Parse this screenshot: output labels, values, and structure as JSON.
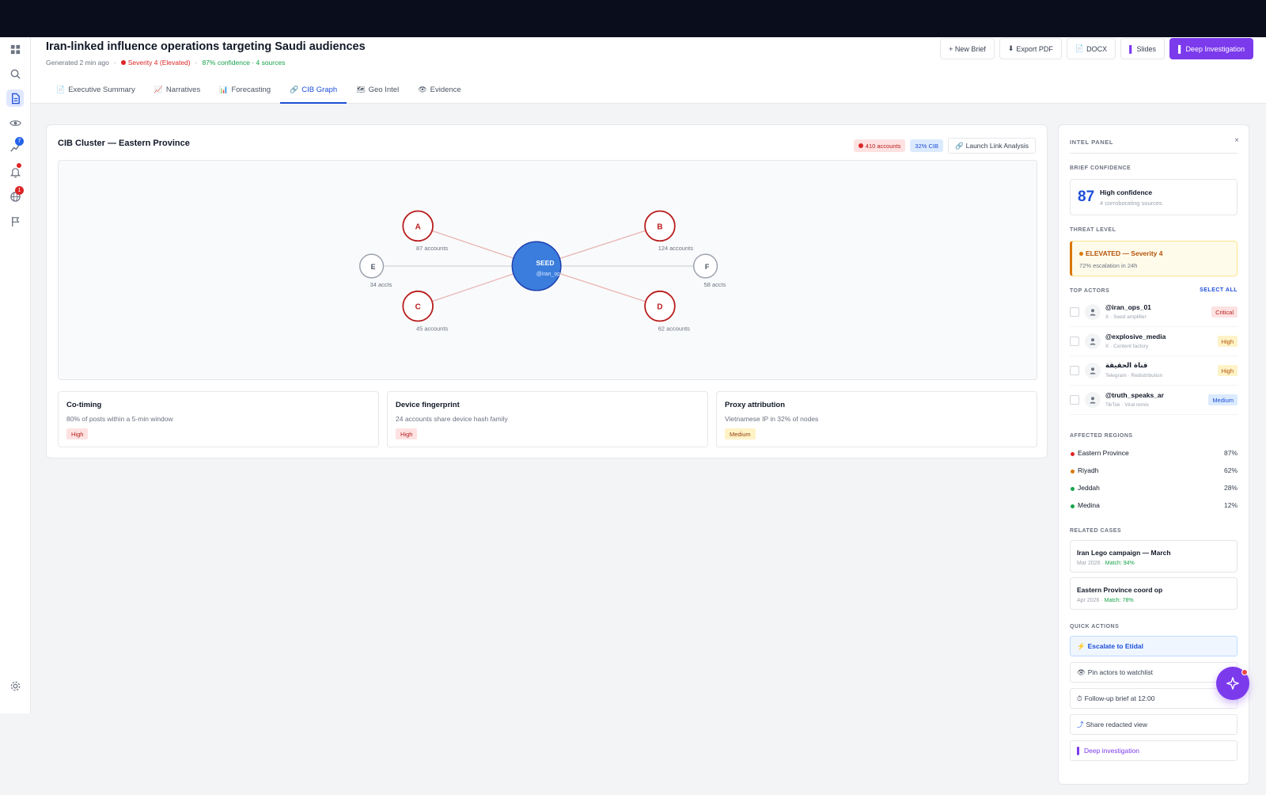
{
  "header": {
    "title": "Iran-linked influence operations targeting Saudi audiences",
    "generated": "Generated 2 min ago",
    "severity": "Severity 4 (Elevated)",
    "confidence": "87% confidence · 4 sources",
    "actions": {
      "new_brief": "+ New Brief",
      "export_pdf": "Export PDF",
      "docx": "DOCX",
      "slides": "Slides",
      "deep_investigation": "Deep Investigation"
    }
  },
  "tabs": [
    {
      "label": "Executive Summary",
      "icon": "document-icon"
    },
    {
      "label": "Narratives",
      "icon": "trend-icon"
    },
    {
      "label": "Forecasting",
      "icon": "bar-chart-icon"
    },
    {
      "label": "CIB Graph",
      "icon": "link-icon",
      "active": true
    },
    {
      "label": "Geo Intel",
      "icon": "map-icon"
    },
    {
      "label": "Evidence",
      "icon": "eye-icon"
    }
  ],
  "sidebar": {
    "badges": {
      "analysis": "7",
      "geo": "1"
    }
  },
  "cib": {
    "title": "CIB Cluster — Eastern Province",
    "accounts_badge": "410 accounts",
    "cib_badge": "32% CIB",
    "launch_button": "Launch Link Analysis",
    "nodes": {
      "seed": {
        "label": "SEED",
        "sub": "@iran_op"
      },
      "a": {
        "label": "A",
        "sub": "87 accounts"
      },
      "b": {
        "label": "B",
        "sub": "124 accounts"
      },
      "c": {
        "label": "C",
        "sub": "45 accounts"
      },
      "d": {
        "label": "D",
        "sub": "62 accounts"
      },
      "e": {
        "label": "E",
        "sub": "34 accts"
      },
      "f": {
        "label": "F",
        "sub": "58 accts"
      }
    },
    "signals": [
      {
        "title": "Co-timing",
        "desc": "80% of posts within a 5-min window",
        "level": "High"
      },
      {
        "title": "Device fingerprint",
        "desc": "24 accounts share device hash family",
        "level": "High"
      },
      {
        "title": "Proxy attribution",
        "desc": "Vietnamese IP in 32% of nodes",
        "level": "Medium"
      }
    ]
  },
  "panel": {
    "title": "INTEL PANEL",
    "close": "×",
    "brief_confidence_label": "BRIEF CONFIDENCE",
    "confidence_value": "87",
    "confidence_text": "High confidence",
    "confidence_sub": "4 corroborating sources",
    "threat_label": "THREAT LEVEL",
    "threat_text": "ELEVATED — Severity 4",
    "threat_sub": "72% escalation in 24h",
    "actors_label": "TOP ACTORS",
    "select_all": "SELECT ALL",
    "actors": [
      {
        "name": "@iran_ops_01",
        "sub": "X · Seed amplifier",
        "level": "Critical"
      },
      {
        "name": "@explosive_media",
        "sub": "X · Content factory",
        "level": "High"
      },
      {
        "name": "قناة الحقيقة",
        "sub": "Telegram · Redistribution",
        "level": "High"
      },
      {
        "name": "@truth_speaks_ar",
        "sub": "TikTok · Viral remix",
        "level": "Medium"
      }
    ],
    "regions_label": "AFFECTED REGIONS",
    "regions": [
      {
        "name": "Eastern Province",
        "pct": "87%",
        "color": "#dc2626"
      },
      {
        "name": "Riyadh",
        "pct": "62%",
        "color": "#d97706"
      },
      {
        "name": "Jeddah",
        "pct": "28%",
        "color": "#16a34a"
      },
      {
        "name": "Medina",
        "pct": "12%",
        "color": "#16a34a"
      }
    ],
    "cases_label": "RELATED CASES",
    "cases": [
      {
        "title": "Iran Lego campaign — March",
        "date": "Mar 2026 · ",
        "match": "Match: 94%"
      },
      {
        "title": "Eastern Province coord op",
        "date": "Apr 2026 · ",
        "match": "Match: 78%"
      }
    ],
    "quick_label": "QUICK ACTIONS",
    "quick_actions": {
      "escalate": "Escalate to Etidal",
      "pin": "Pin actors to watchlist",
      "followup": "Follow-up brief at 12:00",
      "share": "Share redacted view",
      "deep": "Deep investigation"
    }
  },
  "colors": {
    "accent": "#1d4ed8",
    "primary_action": "#7c3aed",
    "danger": "#dc2626",
    "seed_node": "#3b7ddd"
  }
}
